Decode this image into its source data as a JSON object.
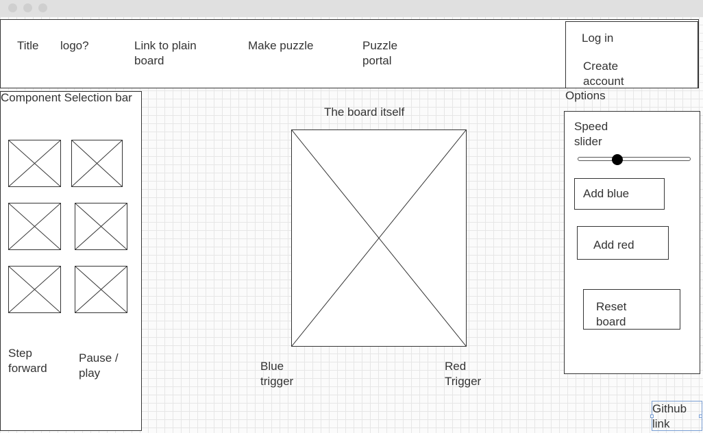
{
  "header": {
    "title": "Title",
    "logo": "logo?",
    "link_plain_board": "Link to plain board",
    "make_puzzle": "Make puzzle",
    "puzzle_portal": "Puzzle portal",
    "log_in": "Log in",
    "create_account": "Create account"
  },
  "sidebar": {
    "title": "Component Selection bar",
    "step_forward": "Step forward",
    "pause_play": "Pause / play"
  },
  "board": {
    "title": "The board itself",
    "blue_trigger": "Blue trigger",
    "red_trigger": "Red Trigger"
  },
  "options": {
    "title": "Options",
    "speed_slider_label": "Speed slider",
    "speed_value": 0.35,
    "add_blue": "Add blue",
    "add_red": "Add red",
    "reset_board": "Reset board"
  },
  "footer": {
    "github_link": "Github link"
  }
}
